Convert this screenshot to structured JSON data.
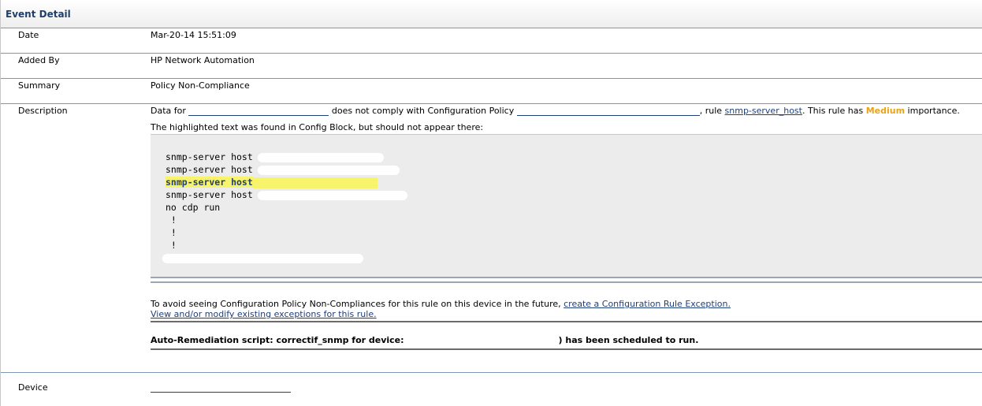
{
  "panel": {
    "title": "Event Detail"
  },
  "rows": {
    "date": {
      "label": "Date",
      "value": "Mar-20-14 15:51:09"
    },
    "added_by": {
      "label": "Added By",
      "value": "HP Network Automation"
    },
    "summary": {
      "label": "Summary",
      "value": "Policy Non-Compliance"
    },
    "description": {
      "label": "Description",
      "prefix": "Data for ",
      "middle": " does not comply with Configuration Policy ",
      "rule_prefix": ", rule ",
      "rule_link": "snmp-server_host",
      "importance_prefix": ". This rule has ",
      "importance": "Medium",
      "importance_suffix": " importance.",
      "highlight_note": "The highlighted text was found in Config Block, but should not appear there:",
      "config_lines": [
        "snmp-server host",
        "snmp-server host",
        "snmp-server host",
        "snmp-server host",
        "no cdp run",
        " !",
        " !",
        " !"
      ],
      "avoid_text": "To avoid seeing Configuration Policy Non-Compliances for this rule on this device in the future, ",
      "exception_link": "create a Configuration Rule Exception.",
      "view_link": "View and/or modify existing exceptions for this rule.",
      "remed_prefix": "Auto-Remediation script: correctif_snmp for device:",
      "remed_suffix": ") has been scheduled to run."
    },
    "device": {
      "label": "Device"
    }
  },
  "colors": {
    "title": "#1f3f6c",
    "link": "#1f3f7a",
    "importance": "#e8a317",
    "highlight": "#f7f36a",
    "config_bg": "#ececec"
  }
}
